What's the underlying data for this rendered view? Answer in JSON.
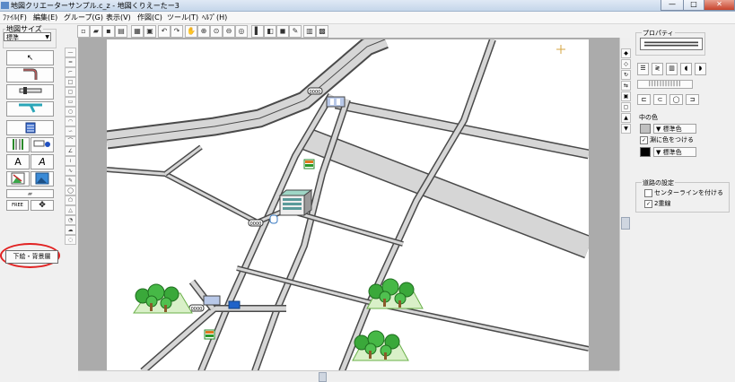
{
  "window": {
    "title": "地図クリエーターサンプル.c_z - 地図くりえーたー3",
    "minimize": "—",
    "maximize": "□",
    "close": "✕"
  },
  "menu": [
    "ﾌｧｲﾙ(F)",
    "編集(E)",
    "グループ(G)",
    "表示(V)",
    "作図(C)",
    "ツール(T)",
    "ﾍﾙﾌﾟ(H)"
  ],
  "left_panel": {
    "map_size_label": "地図サイズ",
    "map_size_value": "標準",
    "text_tool_1": "A",
    "text_tool_2": "A",
    "free_label": "FREE",
    "move_symbol": "✥",
    "background_layer_button": "下絵・背景層"
  },
  "map": {
    "road_signs": [
      "0000",
      "0000",
      "0000"
    ],
    "road_color": "#d6d6d6",
    "road_edge_color": "#4a4a4a",
    "highlight_color": "#e12222"
  },
  "properties": {
    "property_label": "プロパティ",
    "fill_color_label": "中の色",
    "standard_color": "標準色",
    "edge_color_label": "淵に色をつける",
    "edge_checked": true,
    "edge_standard_color": "標準色",
    "road_settings_label": "道路の設定",
    "centerline_label": "センターラインを付ける",
    "centerline_checked": false,
    "double_line_label": "2重線",
    "double_line_checked": true
  }
}
